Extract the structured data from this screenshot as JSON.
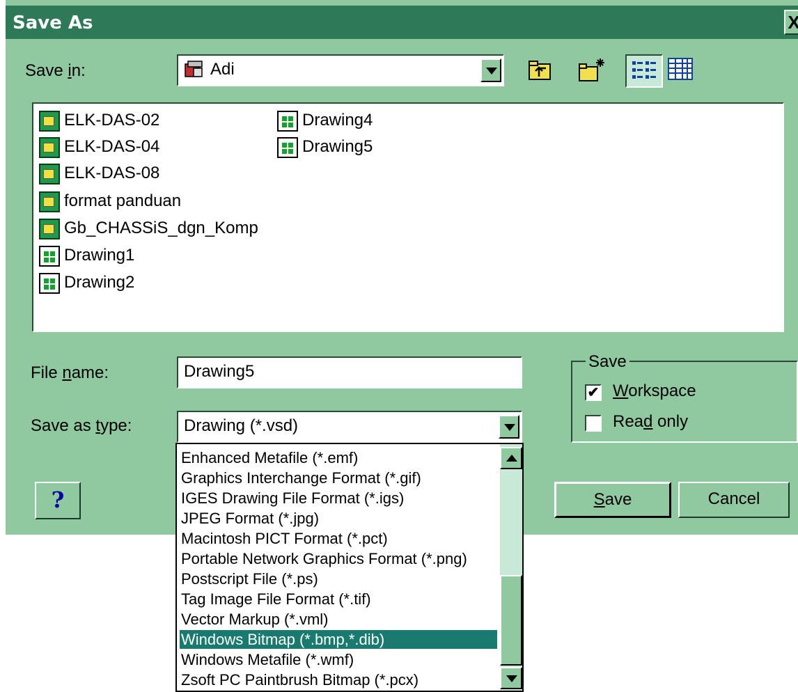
{
  "window": {
    "title": "Save As",
    "close_glyph": "X"
  },
  "save_in": {
    "label_pre": "Save ",
    "label_u": "i",
    "label_post": "n:",
    "value": "Adi"
  },
  "toolbar": {
    "icons": [
      "up-one-level-icon",
      "create-new-folder-icon",
      "list-view-icon",
      "details-view-icon"
    ]
  },
  "files": [
    {
      "name": "ELK-DAS-02",
      "type": "folder"
    },
    {
      "name": "ELK-DAS-04",
      "type": "folder"
    },
    {
      "name": "ELK-DAS-08",
      "type": "folder"
    },
    {
      "name": "format panduan",
      "type": "folder"
    },
    {
      "name": "Gb_CHASSiS_dgn_Komp",
      "type": "folder"
    },
    {
      "name": "Drawing1",
      "type": "drawing"
    },
    {
      "name": "Drawing2",
      "type": "drawing"
    },
    {
      "name": "Drawing4",
      "type": "drawing"
    },
    {
      "name": "Drawing5",
      "type": "drawing"
    }
  ],
  "file_name": {
    "label_pre": "File ",
    "label_u": "n",
    "label_post": "ame:",
    "value": "Drawing5"
  },
  "save_as_type": {
    "label_pre": "Save as ",
    "label_u": "t",
    "label_post": "ype:",
    "value": "Drawing (*.vsd)"
  },
  "save_group": {
    "title": "Save",
    "workspace": {
      "label_u": "W",
      "label_post": "orkspace",
      "checked": true,
      "mark": "✔"
    },
    "read_only": {
      "label_pre": "Rea",
      "label_u": "d",
      "label_post": " only",
      "checked": false
    }
  },
  "buttons": {
    "help": "?",
    "save_u": "S",
    "save_post": "ave",
    "cancel": "Cancel"
  },
  "type_options": [
    "Enhanced Metafile (*.emf)",
    "Graphics Interchange Format (*.gif)",
    "IGES Drawing File Format (*.igs)",
    "JPEG Format (*.jpg)",
    "Macintosh PICT Format (*.pct)",
    "Portable Network Graphics Format (*.png)",
    "Postscript File (*.ps)",
    "Tag Image File Format (*.tif)",
    "Vector Markup (*.vml)",
    "Windows Bitmap (*.bmp,*.dib)",
    "Windows Metafile (*.wmf)",
    "Zsoft PC Paintbrush Bitmap (*.pcx)"
  ],
  "selected_option": "Windows Bitmap (*.bmp,*.dib)",
  "colors": {
    "dialog_bg": "#90c8a0",
    "titlebar": "#2e7a56",
    "selection": "#1a7a70"
  }
}
